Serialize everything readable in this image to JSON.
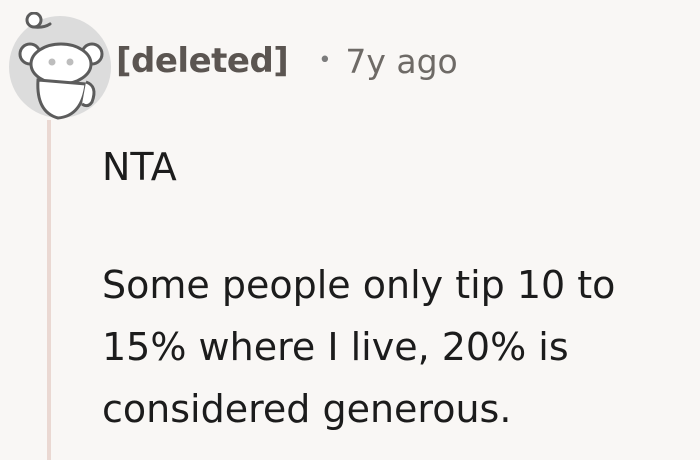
{
  "comment": {
    "author": "[deleted]",
    "separator": "•",
    "timestamp": "7y ago",
    "paragraphs": [
      "NTA",
      "Some people only tip 10 to 15% where I live, 20% is considered generous."
    ]
  },
  "icons": {
    "avatar": "deleted-user-snoo-avatar-icon"
  },
  "colors": {
    "background": "#f9f7f5",
    "thread_line": "#ead8d2",
    "author": "#5b5551",
    "text": "#1c1c1c"
  }
}
